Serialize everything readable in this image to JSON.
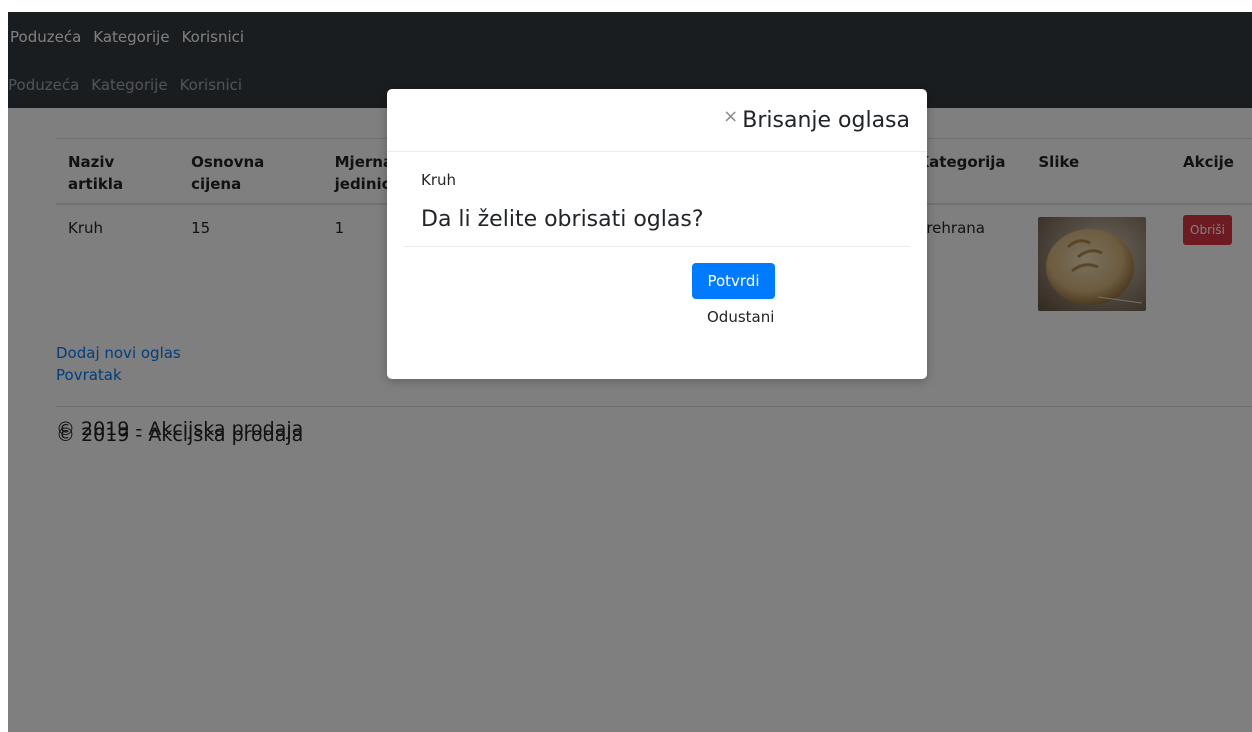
{
  "nav": {
    "items": [
      "Poduzeća",
      "Kategorije",
      "Korisnici"
    ]
  },
  "table": {
    "headers": [
      "Naziv artikla",
      "Osnovna cijena",
      "Mjerna jedinica",
      "",
      "",
      "",
      "",
      "Kategorija",
      "Slike",
      "Akcije"
    ],
    "row": {
      "name": "Kruh",
      "price": "15",
      "unit": "1",
      "category": "Prehrana",
      "action_label": "Obriši"
    }
  },
  "links": {
    "add_new": "Dodaj novi oglas",
    "back": "Povratak"
  },
  "footer": {
    "text": "© 2019 - Akcijska prodaja"
  },
  "modal": {
    "title": "Brisanje oglasa",
    "item_name": "Kruh",
    "question": "Da li želite obrisati oglas?",
    "confirm_label": "Potvrdi",
    "cancel_label": "Odustani",
    "close_symbol": "×"
  },
  "colors": {
    "navbar": "#343a40",
    "primary": "#007bff",
    "danger": "#dc3545"
  }
}
